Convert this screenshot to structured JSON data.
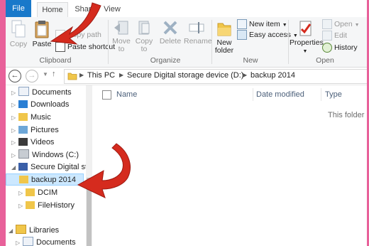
{
  "tabs": {
    "file": "File",
    "home": "Home",
    "share": "Share",
    "view": "View"
  },
  "clipboard": {
    "copy": "Copy",
    "paste": "Paste",
    "copy_path": "Copy path",
    "paste_shortcut": "Paste shortcut",
    "label": "Clipboard"
  },
  "organize": {
    "move_to_1": "Move",
    "move_to_2": "to",
    "copy_to_1": "Copy",
    "copy_to_2": "to",
    "delete": "Delete",
    "rename": "Rename",
    "label": "Organize"
  },
  "new_group": {
    "new_folder_1": "New",
    "new_folder_2": "folder",
    "new_item": "New item",
    "easy_access": "Easy access",
    "label": "New"
  },
  "open_group": {
    "properties": "Properties",
    "open": "Open",
    "edit": "Edit",
    "history": "History",
    "label": "Open"
  },
  "address": {
    "crumbs": [
      "This PC",
      "Secure Digital storage device (D:)",
      "backup 2014"
    ]
  },
  "nav": {
    "items": [
      "Documents",
      "Downloads",
      "Music",
      "Pictures",
      "Videos",
      "Windows (C:)",
      "Secure Digital sto",
      "backup 2014",
      "DCIM",
      "FileHistory",
      "Libraries",
      "Documents"
    ]
  },
  "content": {
    "columns": {
      "name": "Name",
      "date_modified": "Date modified",
      "type": "Type"
    },
    "empty_message": "This folder is"
  },
  "colors": {
    "accent": "#1979ca",
    "selection": "#cce8ff",
    "arrow": "#d52b1e",
    "frame": "#e8619a"
  }
}
